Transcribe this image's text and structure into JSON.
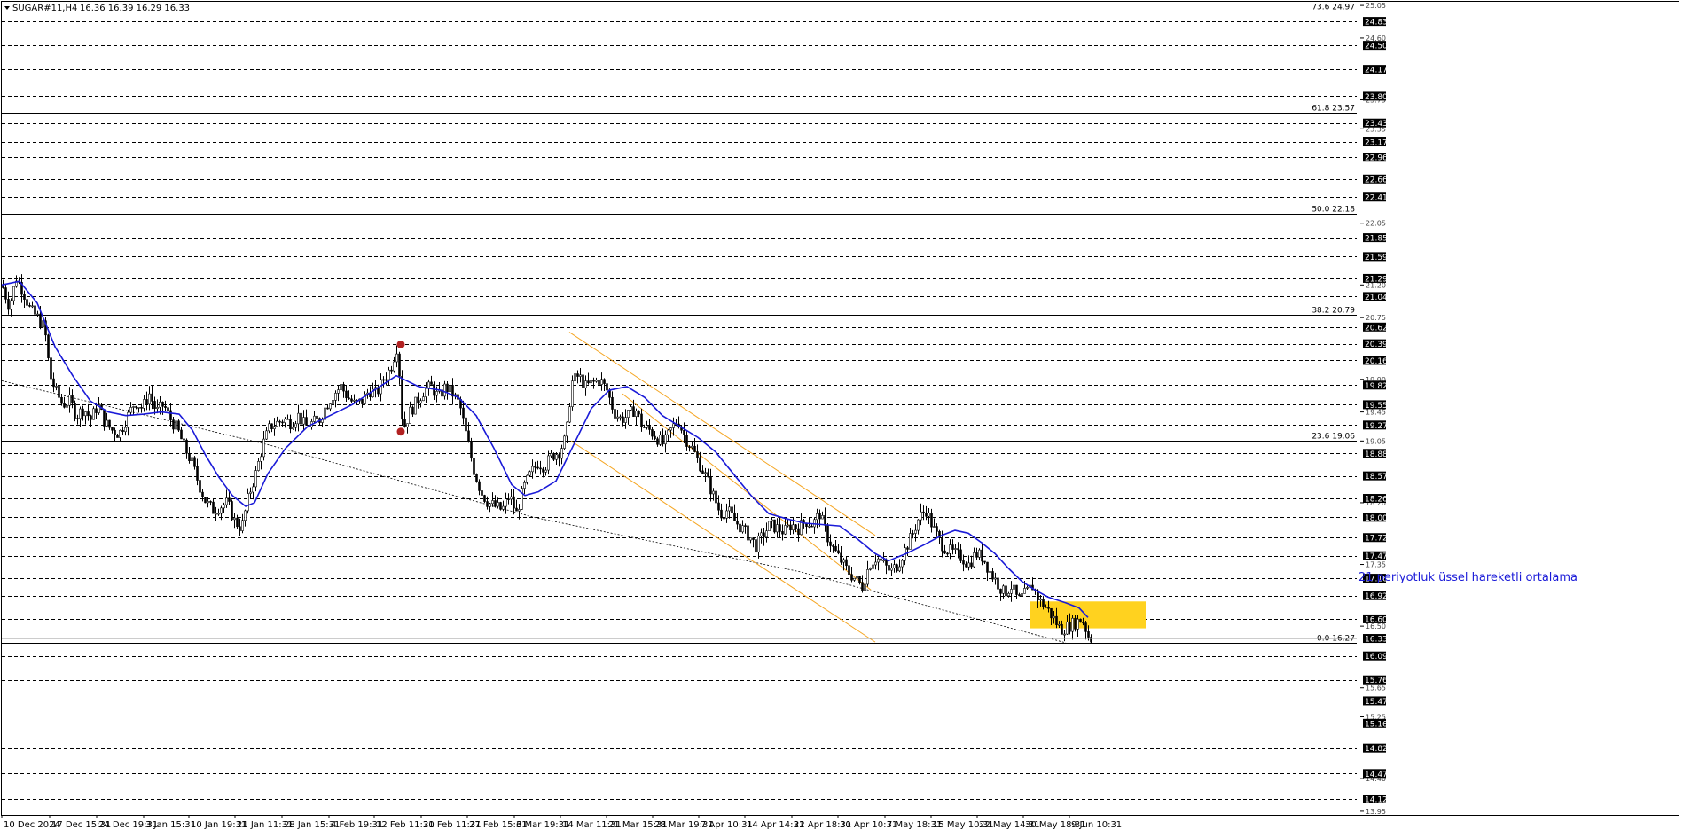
{
  "header": {
    "symbol": "SUGAR#11,H4",
    "ohlc": "16.36 16.39 16.29 16.33"
  },
  "annotation": {
    "text": "21 periyotluk üssel hareketli ortalama",
    "color": "#1a1ad8"
  },
  "colors": {
    "ema": "#1a1ad8",
    "channel": "#f5a623",
    "highlight": "#ffd21f",
    "marker": "#b22222",
    "grid": "#000000",
    "candle": "#000000"
  },
  "chart_data": {
    "type": "candlestick",
    "title": "SUGAR#11,H4",
    "ylim": [
      13.9,
      25.1
    ],
    "x_range": [
      0,
      1230
    ],
    "x_labels": [
      {
        "x": 0,
        "label": "10 Dec 2024"
      },
      {
        "x": 54,
        "label": "17 Dec 15:31"
      },
      {
        "x": 107,
        "label": "24 Dec 19:31"
      },
      {
        "x": 160,
        "label": "3 Jan 15:31"
      },
      {
        "x": 211,
        "label": "10 Jan 19:31"
      },
      {
        "x": 263,
        "label": "21 Jan 11:31"
      },
      {
        "x": 316,
        "label": "28 Jan 15:31"
      },
      {
        "x": 369,
        "label": "4 Feb 19:31"
      },
      {
        "x": 420,
        "label": "12 Feb 11:31"
      },
      {
        "x": 473,
        "label": "20 Feb 11:31"
      },
      {
        "x": 525,
        "label": "27 Feb 15:31"
      },
      {
        "x": 578,
        "label": "6 Mar 19:31"
      },
      {
        "x": 630,
        "label": "14 Mar 11:31"
      },
      {
        "x": 682,
        "label": "21 Mar 15:31"
      },
      {
        "x": 734,
        "label": "28 Mar 19:31"
      },
      {
        "x": 786,
        "label": "7 Apr 10:31"
      },
      {
        "x": 838,
        "label": "14 Apr 14:31"
      },
      {
        "x": 891,
        "label": "22 Apr 18:31"
      },
      {
        "x": 943,
        "label": "30 Apr 10:31"
      },
      {
        "x": 996,
        "label": "7 May 18:31"
      },
      {
        "x": 1048,
        "label": "15 May 10:31"
      },
      {
        "x": 1100,
        "label": "22 May 14:31"
      },
      {
        "x": 1152,
        "label": "30 May 18:31"
      },
      {
        "x": 1204,
        "label": "9 Jun 10:31"
      }
    ],
    "y_ticks_boxed": [
      "24.83",
      "24.50",
      "24.17",
      "23.80",
      "23.43",
      "23.17",
      "22.96",
      "22.66",
      "22.41",
      "21.85",
      "21.59",
      "21.29",
      "21.04",
      "20.62",
      "20.39",
      "20.16",
      "19.82",
      "19.55",
      "19.27",
      "18.88",
      "18.57",
      "18.26",
      "18.00",
      "17.72",
      "17.47",
      "17.16",
      "16.92",
      "16.60",
      "16.33",
      "16.09",
      "15.76",
      "15.47",
      "15.16",
      "14.82",
      "14.47",
      "14.12"
    ],
    "y_ticks_small": [
      "25.05",
      "24.60",
      "23.75",
      "23.35",
      "22.05",
      "21.20",
      "20.75",
      "19.90",
      "19.45",
      "19.05",
      "18.20",
      "17.35",
      "16.50",
      "15.65",
      "15.25",
      "14.40",
      "13.95"
    ],
    "dashed_levels": [
      24.83,
      24.5,
      24.17,
      23.8,
      23.43,
      23.17,
      22.96,
      22.66,
      22.41,
      21.85,
      21.59,
      21.29,
      21.04,
      20.62,
      20.39,
      20.16,
      19.82,
      19.55,
      19.27,
      18.88,
      18.57,
      18.26,
      18.0,
      17.72,
      17.47,
      17.16,
      16.92,
      16.6,
      16.09,
      15.76,
      15.47,
      15.16,
      14.82,
      14.47,
      14.12
    ],
    "fib_levels": [
      {
        "label": "73.6 24.97",
        "value": 24.97
      },
      {
        "label": "61.8 23.57",
        "value": 23.57
      },
      {
        "label": "50.0 22.18",
        "value": 22.18
      },
      {
        "label": "38.2 20.79",
        "value": 20.79
      },
      {
        "label": "23.6 19.06",
        "value": 19.06
      },
      {
        "label": "0.0 16.27",
        "value": 16.27
      }
    ],
    "current_price": "16.33",
    "series": [
      {
        "name": "21 periyotluk üssel hareketli ortalama",
        "points": [
          [
            0,
            21.2
          ],
          [
            20,
            21.25
          ],
          [
            40,
            20.95
          ],
          [
            60,
            20.35
          ],
          [
            80,
            19.95
          ],
          [
            100,
            19.6
          ],
          [
            120,
            19.45
          ],
          [
            140,
            19.4
          ],
          [
            160,
            19.42
          ],
          [
            180,
            19.45
          ],
          [
            200,
            19.42
          ],
          [
            215,
            19.2
          ],
          [
            230,
            18.85
          ],
          [
            245,
            18.55
          ],
          [
            260,
            18.3
          ],
          [
            275,
            18.15
          ],
          [
            285,
            18.2
          ],
          [
            300,
            18.6
          ],
          [
            320,
            18.95
          ],
          [
            345,
            19.25
          ],
          [
            370,
            19.4
          ],
          [
            395,
            19.55
          ],
          [
            420,
            19.75
          ],
          [
            445,
            19.95
          ],
          [
            470,
            19.8
          ],
          [
            495,
            19.75
          ],
          [
            515,
            19.65
          ],
          [
            535,
            19.4
          ],
          [
            555,
            18.95
          ],
          [
            575,
            18.45
          ],
          [
            590,
            18.3
          ],
          [
            605,
            18.35
          ],
          [
            625,
            18.5
          ],
          [
            645,
            19.0
          ],
          [
            665,
            19.5
          ],
          [
            685,
            19.75
          ],
          [
            705,
            19.8
          ],
          [
            725,
            19.65
          ],
          [
            745,
            19.4
          ],
          [
            765,
            19.25
          ],
          [
            785,
            19.1
          ],
          [
            805,
            18.9
          ],
          [
            825,
            18.6
          ],
          [
            845,
            18.3
          ],
          [
            865,
            18.05
          ],
          [
            885,
            17.98
          ],
          [
            905,
            17.92
          ],
          [
            925,
            17.9
          ],
          [
            945,
            17.88
          ],
          [
            965,
            17.7
          ],
          [
            985,
            17.5
          ],
          [
            1000,
            17.4
          ],
          [
            1020,
            17.5
          ],
          [
            1040,
            17.62
          ],
          [
            1060,
            17.75
          ],
          [
            1075,
            17.82
          ],
          [
            1090,
            17.78
          ],
          [
            1105,
            17.65
          ],
          [
            1120,
            17.5
          ],
          [
            1135,
            17.3
          ],
          [
            1150,
            17.12
          ],
          [
            1165,
            17.0
          ],
          [
            1180,
            16.9
          ],
          [
            1200,
            16.82
          ],
          [
            1215,
            16.75
          ],
          [
            1225,
            16.62
          ]
        ]
      },
      {
        "name": "",
        "description": "dotted trendline",
        "points": [
          [
            0,
            19.88
          ],
          [
            300,
            19.0
          ],
          [
            600,
            18.0
          ],
          [
            900,
            17.25
          ],
          [
            1200,
            16.27
          ]
        ]
      }
    ],
    "channel": {
      "upper": [
        [
          640,
          20.55
        ],
        [
          985,
          17.75
        ]
      ],
      "lower": [
        [
          642,
          19.05
        ],
        [
          985,
          16.28
        ]
      ],
      "mid": [
        [
          700,
          19.7
        ],
        [
          980,
          17.0
        ]
      ]
    },
    "highlight_zone": {
      "x0": 1160,
      "x1": 1290,
      "y_top": 16.84,
      "y_bottom": 16.47
    },
    "markers": [
      [
        450,
        20.38
      ],
      [
        450,
        19.18
      ]
    ],
    "price_path": [
      [
        0,
        21.2
      ],
      [
        8,
        20.9
      ],
      [
        16,
        21.3
      ],
      [
        24,
        21.1
      ],
      [
        32,
        20.85
      ],
      [
        40,
        20.75
      ],
      [
        48,
        20.6
      ],
      [
        54,
        19.95
      ],
      [
        60,
        19.75
      ],
      [
        68,
        19.55
      ],
      [
        76,
        19.6
      ],
      [
        84,
        19.4
      ],
      [
        92,
        19.5
      ],
      [
        100,
        19.35
      ],
      [
        108,
        19.55
      ],
      [
        116,
        19.3
      ],
      [
        124,
        19.2
      ],
      [
        132,
        19.15
      ],
      [
        140,
        19.35
      ],
      [
        150,
        19.6
      ],
      [
        158,
        19.5
      ],
      [
        166,
        19.7
      ],
      [
        174,
        19.45
      ],
      [
        182,
        19.55
      ],
      [
        190,
        19.35
      ],
      [
        198,
        19.2
      ],
      [
        206,
        18.95
      ],
      [
        214,
        18.75
      ],
      [
        222,
        18.45
      ],
      [
        230,
        18.2
      ],
      [
        238,
        18.1
      ],
      [
        246,
        18.15
      ],
      [
        254,
        18.2
      ],
      [
        262,
        17.95
      ],
      [
        270,
        17.85
      ],
      [
        278,
        18.3
      ],
      [
        286,
        18.6
      ],
      [
        294,
        19.0
      ],
      [
        302,
        19.25
      ],
      [
        310,
        19.3
      ],
      [
        318,
        19.35
      ],
      [
        326,
        19.3
      ],
      [
        334,
        19.4
      ],
      [
        342,
        19.25
      ],
      [
        350,
        19.3
      ],
      [
        358,
        19.35
      ],
      [
        366,
        19.55
      ],
      [
        374,
        19.7
      ],
      [
        382,
        19.8
      ],
      [
        390,
        19.65
      ],
      [
        398,
        19.55
      ],
      [
        406,
        19.6
      ],
      [
        414,
        19.75
      ],
      [
        422,
        19.7
      ],
      [
        430,
        19.9
      ],
      [
        438,
        20.05
      ],
      [
        446,
        20.38
      ],
      [
        452,
        19.2
      ],
      [
        460,
        19.45
      ],
      [
        468,
        19.6
      ],
      [
        476,
        19.75
      ],
      [
        484,
        19.8
      ],
      [
        492,
        19.65
      ],
      [
        500,
        19.8
      ],
      [
        508,
        19.7
      ],
      [
        516,
        19.55
      ],
      [
        524,
        19.1
      ],
      [
        532,
        18.65
      ],
      [
        540,
        18.35
      ],
      [
        548,
        18.2
      ],
      [
        556,
        18.15
      ],
      [
        564,
        18.1
      ],
      [
        572,
        18.3
      ],
      [
        580,
        18.05
      ],
      [
        588,
        18.4
      ],
      [
        596,
        18.6
      ],
      [
        604,
        18.75
      ],
      [
        612,
        18.7
      ],
      [
        620,
        18.85
      ],
      [
        628,
        18.9
      ],
      [
        636,
        19.1
      ],
      [
        642,
        19.85
      ],
      [
        650,
        19.95
      ],
      [
        658,
        19.8
      ],
      [
        666,
        19.85
      ],
      [
        674,
        19.9
      ],
      [
        682,
        19.75
      ],
      [
        690,
        19.45
      ],
      [
        698,
        19.35
      ],
      [
        706,
        19.4
      ],
      [
        714,
        19.5
      ],
      [
        722,
        19.25
      ],
      [
        730,
        19.2
      ],
      [
        738,
        19.1
      ],
      [
        746,
        19.0
      ],
      [
        754,
        19.2
      ],
      [
        762,
        19.35
      ],
      [
        770,
        19.1
      ],
      [
        778,
        18.95
      ],
      [
        786,
        18.75
      ],
      [
        794,
        18.55
      ],
      [
        802,
        18.3
      ],
      [
        810,
        18.05
      ],
      [
        818,
        18.1
      ],
      [
        826,
        17.95
      ],
      [
        834,
        17.85
      ],
      [
        842,
        17.75
      ],
      [
        850,
        17.6
      ],
      [
        858,
        17.75
      ],
      [
        866,
        17.9
      ],
      [
        874,
        17.85
      ],
      [
        882,
        17.8
      ],
      [
        890,
        17.9
      ],
      [
        898,
        17.85
      ],
      [
        906,
        17.95
      ],
      [
        914,
        17.9
      ],
      [
        922,
        18.05
      ],
      [
        930,
        17.75
      ],
      [
        938,
        17.55
      ],
      [
        946,
        17.4
      ],
      [
        954,
        17.25
      ],
      [
        962,
        17.15
      ],
      [
        970,
        17.05
      ],
      [
        978,
        17.35
      ],
      [
        986,
        17.45
      ],
      [
        994,
        17.35
      ],
      [
        1002,
        17.25
      ],
      [
        1010,
        17.35
      ],
      [
        1018,
        17.55
      ],
      [
        1026,
        17.75
      ],
      [
        1034,
        18.0
      ],
      [
        1042,
        18.1
      ],
      [
        1050,
        17.85
      ],
      [
        1058,
        17.65
      ],
      [
        1066,
        17.55
      ],
      [
        1074,
        17.5
      ],
      [
        1082,
        17.45
      ],
      [
        1090,
        17.35
      ],
      [
        1098,
        17.5
      ],
      [
        1106,
        17.45
      ],
      [
        1114,
        17.25
      ],
      [
        1122,
        17.1
      ],
      [
        1130,
        16.95
      ],
      [
        1138,
        17.05
      ],
      [
        1146,
        16.85
      ],
      [
        1154,
        16.95
      ],
      [
        1162,
        17.05
      ],
      [
        1170,
        16.85
      ],
      [
        1178,
        16.75
      ],
      [
        1186,
        16.6
      ],
      [
        1194,
        16.45
      ],
      [
        1202,
        16.5
      ],
      [
        1210,
        16.55
      ],
      [
        1218,
        16.6
      ],
      [
        1226,
        16.33
      ]
    ]
  }
}
